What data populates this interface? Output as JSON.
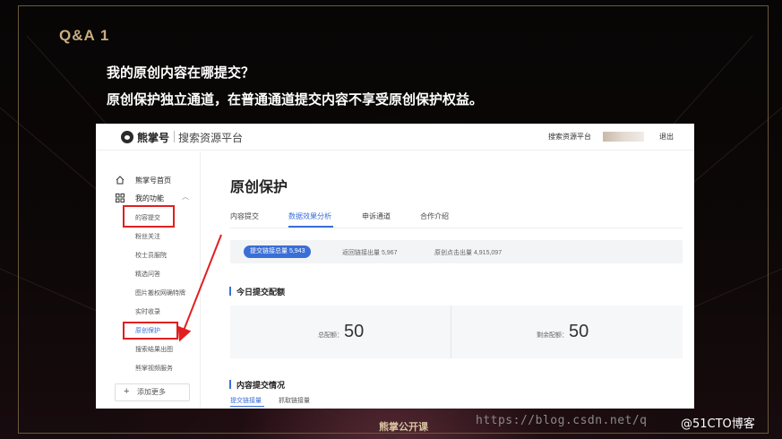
{
  "slide": {
    "qa_title": "Q&A  1",
    "question": "我的原创内容在哪提交？",
    "answer": "原创保护独立通道，在普通通道提交内容不享受原创保护权益。",
    "footer": "熊掌公开课",
    "watermark_url": "https://blog.csdn.net/q",
    "watermark_site": "@51CTO博客"
  },
  "app": {
    "brand": "熊掌号",
    "brand_sub": "搜索资源平台",
    "top_link": "搜索资源平台",
    "logout": "退出"
  },
  "sidebar": {
    "home": "熊掌号首页",
    "functions": "我的功能",
    "items": [
      {
        "label": "的容提交"
      },
      {
        "label": "粉丝关注"
      },
      {
        "label": "校士员服院"
      },
      {
        "label": "精选问答"
      },
      {
        "label": "图片搬权网确特牌"
      },
      {
        "label": "实时收录"
      },
      {
        "label": "原创保护"
      },
      {
        "label": "搜索结果出图"
      },
      {
        "label": "熊掌视频服务"
      }
    ],
    "add_more": "添加更多"
  },
  "main": {
    "title": "原创保护",
    "tabs": [
      {
        "label": "内容提交"
      },
      {
        "label": "数据效果分析"
      },
      {
        "label": "申诉通道"
      },
      {
        "label": "合作介绍"
      }
    ],
    "stats": {
      "pill": "提交链接总量 5,943",
      "returned": "返回链接出量 5,967",
      "clicks": "原创点击出量 4,915,097"
    },
    "quota_section": "今日提交配额",
    "quota_total_label": "总配额：",
    "quota_total_value": "50",
    "quota_left_label": "剩余配额：",
    "quota_left_value": "50",
    "content_section": "内容提交情况",
    "sub_tabs": [
      {
        "label": "提交链接量"
      },
      {
        "label": "抓取链接量"
      }
    ]
  },
  "colors": {
    "accent": "#3a6fd6",
    "highlight": "#e02020",
    "qa_gold": "#c8ad7e"
  }
}
